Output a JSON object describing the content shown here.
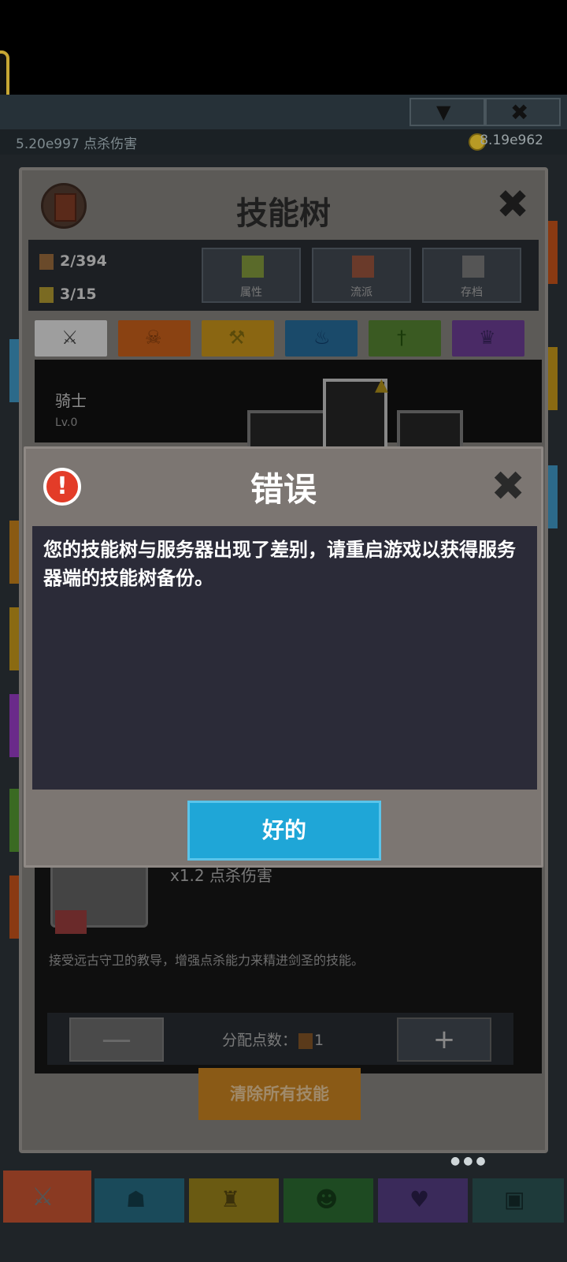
{
  "top_bar": {
    "left_stat": "5.20e997 点杀伤害",
    "right_stat": "8.19e962"
  },
  "panel": {
    "title": "技能树",
    "close_icon": "close-icon",
    "skill_points": "2/394",
    "level_points": "3/15",
    "tools": [
      {
        "label": "属性",
        "icon": "attribute-chart-icon"
      },
      {
        "label": "流派",
        "icon": "school-color-icon"
      },
      {
        "label": "存档",
        "icon": "save-tree-icon"
      }
    ],
    "class_tabs": [
      {
        "icon": "sword-icon",
        "color": "#9e9e9e"
      },
      {
        "icon": "demon-icon",
        "color": "#8a4212"
      },
      {
        "icon": "axe-icon",
        "color": "#8a6612"
      },
      {
        "icon": "fire-icon",
        "color": "#1a4a6a"
      },
      {
        "icon": "dagger-icon",
        "color": "#3a5a22"
      },
      {
        "icon": "crown-icon",
        "color": "#4a2a66"
      }
    ]
  },
  "tree": {
    "class_name": "骑士",
    "level": "Lv.0"
  },
  "detail": {
    "multiplier": "x1.2 点杀伤害",
    "description": "接受远古守卫的教导，增强点杀能力来精进剑圣的技能。",
    "alloc_label": "分配点数：",
    "alloc_value": "1",
    "minus_label": "—",
    "plus_label": "+"
  },
  "clear_button": "清除所有技能",
  "pagination_dots": "●●●",
  "dialog": {
    "title": "错误",
    "alert_icon": "!",
    "message": "您的技能树与服务器出现了差别，请重启游戏以获得服务器端的技能树备份。",
    "ok_label": "好的"
  },
  "bottom_nav": [
    {
      "icon": "sword-nav-icon",
      "color": "#8a3a22"
    },
    {
      "icon": "viking-helmet-icon",
      "color": "#1a4a5a"
    },
    {
      "icon": "armor-icon",
      "color": "#6a5a12"
    },
    {
      "icon": "demon-head-icon",
      "color": "#1e4a22"
    },
    {
      "icon": "heart-icon",
      "color": "#3a2a5a"
    },
    {
      "icon": "chest-icon",
      "color": "#1e3a3a"
    }
  ]
}
